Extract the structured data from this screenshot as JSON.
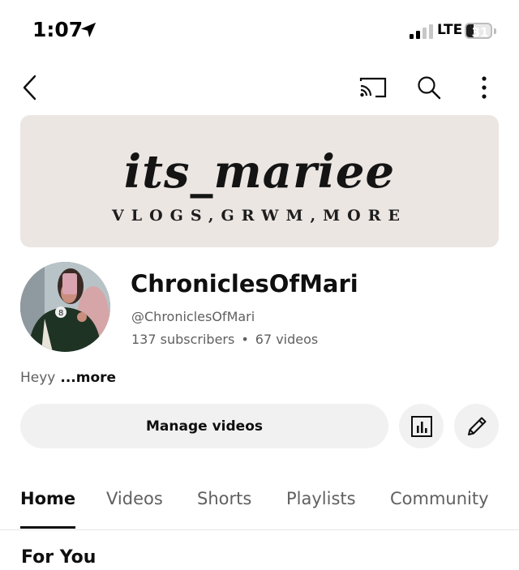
{
  "status_bar": {
    "time": "1:07",
    "network": "LTE",
    "battery_level": "31",
    "battery_fraction": 0.31,
    "location_icon": "location-arrow-icon",
    "signal_icon": "signal-strength-icon"
  },
  "app_bar": {
    "back_icon": "back-chevron-icon",
    "cast_icon": "cast-icon",
    "search_icon": "search-icon",
    "more_icon": "more-vertical-icon"
  },
  "banner": {
    "title": "its_mariee",
    "tagline": "VLOGS,GRWM,MORE"
  },
  "channel": {
    "name": "ChroniclesOfMari",
    "handle": "@ChroniclesOfMari",
    "subscribers": "137 subscribers",
    "separator": "•",
    "videos": "67 videos",
    "description": "Heyy",
    "more_label": "...more"
  },
  "actions": {
    "manage_label": "Manage videos",
    "analytics_icon": "analytics-icon",
    "edit_icon": "pencil-edit-icon"
  },
  "tabs": [
    {
      "label": "Home",
      "active": true
    },
    {
      "label": "Videos",
      "active": false
    },
    {
      "label": "Shorts",
      "active": false
    },
    {
      "label": "Playlists",
      "active": false
    },
    {
      "label": "Community",
      "active": false
    }
  ],
  "section": {
    "title": "For You"
  },
  "colors": {
    "text_primary": "#0f0f0f",
    "text_secondary": "#606060",
    "button_bg": "#f1f1f1",
    "banner_bg": "#ece6e3"
  }
}
